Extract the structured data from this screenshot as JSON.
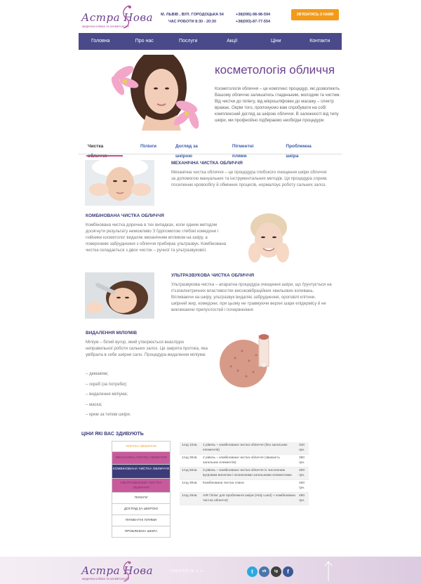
{
  "header": {
    "logo_title": "Астра Нова",
    "logo_sub": "медична клініка та косметологія",
    "address_line1": "М. ЛЬВІВ , ВУЛ. ГОРОДОЦЬКА 54",
    "address_line2": "ЧАС РОБОТИ 8:30 - 20:30",
    "phone1": "+38(096)-98-98-594",
    "phone2": "+38(093)-87-77-554",
    "call_button": "ЗВ'ЯЗАТИСЬ З НАМИ"
  },
  "nav": [
    "Головна",
    "Про нас",
    "Послуги",
    "Акції",
    "Ціни",
    "Контакти"
  ],
  "hero": {
    "title": "косметологія обличчя",
    "text": "Косметологія обличчя – це комплекс процедур, які дозволяють Вашому обличчю залишатись гладеньким, молодим та чистим. Від чистки до пілінгу, від мікрошліфовки до масажу – спектр вражає. Окрім того, пропонуємо вам спробувати на собі комплексний догляд за шкірою обличчя. В залежності від типу шкіри, ми професійно підбираємо необхідні процедури."
  },
  "tabs": [
    "Чистка обличчя",
    "Пілінги",
    "Догляд за шкірою",
    "Пігментні плями",
    "Проблемна шкіра"
  ],
  "sections": {
    "s1": {
      "title": "МЕХАНІЧНА ЧИСТКА ОБЛИЧЧЯ",
      "text": "Механічна чистка обличчя – це процедура глибокого очищення шкіри обличчя за допомогою мануальних та інструментальних методів. Ця процедура сприяє посиленню кровообігу й обмінних процесів, нормалізує роботу сальних залоз."
    },
    "s2": {
      "title": "КОМБІНОВАНА ЧИСТКА ОБЛИЧЧЯ",
      "text": "Комбінована чистка доречна в тих випадках, коли одним методом досягнути результату неможливо З їїдопомогою глибокі комедони і гнійники косметолог видаляє механічним впливом на шкіру, а поверхневе забруднення з обличчя прибирає ультразвук. Комбінована чистка складається з двох чисток – ручної та ультразвукової."
    },
    "s3": {
      "title": "УЛЬТРАЗВУКОВА ЧИСТКА ОБЛИЧЧЯ",
      "text": "Ультразвукова чистка – апаратна процедура очищення шкіри, що ґрунтується на п'єзоелектричних властивостях високовібраційних хвильових коливань. Впливаючи на шкіру, ультразвук видаляє забруднення, ороговілі клітини, шкірний жир, комедони, при цьому не травмуючи верхні шари епідермісу й не викликаючи припухлостей і почервоніння"
    },
    "s4": {
      "title": "ВИДАЛЕННЯ МІЛІУМІВ",
      "text": "Міліум – білий вугор, який утворюється внаслідок неправильної роботи сальних залоз. Це закрита протока, яка увібрала в себе шкірне сало. Процедура видалення міліума:",
      "list": [
        "– демакіяж;",
        "– скраб (за потреби);",
        "– видалення міліума;",
        "– маска;",
        "– крем за типом шкіри."
      ]
    }
  },
  "prices": {
    "title": "ЦІНИ ЯКІ ВАС ЗДИВУЮТЬ",
    "menu": [
      "ЧИСТКА ОБЛИЧЧЯ",
      "МЕХАНІЧНА ЧИСТКА ОБЛИЧЧЯ",
      "КОМБІНОВАНА ЧИСТКА ОБЛИЧЧЯ",
      "УЛЬТРАЗВУКОВА ЧИСТКА ОБЛИЧЧЯ",
      "ПІЛІНГИ",
      "ДОГЛЯД ЗА ШКІРОЮ",
      "ПІГМЕНТНІ ПЛЯМИ",
      "ПРОБЛЕМНА ШКІРА"
    ],
    "rows": [
      {
        "time": "1год 10хв.",
        "desc": "1 рівень – комбінована чистка обличчя (без загальних елементів)",
        "price": "340 грн."
      },
      {
        "time": "1год 30хв.",
        "desc": "2 рівень – комбінована чистка обличчя (зважаєть загальних елементів)",
        "price": "360 грн."
      },
      {
        "time": "1год 50хв.",
        "desc": "3 рівень – комбінована чистка обличчя із численним вугровим висипом і незначними загальними елементами",
        "price": "400 грн."
      },
      {
        "time": "1год 30хв.",
        "desc": "Комбінована чистка спини",
        "price": "450 грн."
      },
      {
        "time": "1год 45хв.",
        "desc": "AIR Пілінг для проблемної шкіри (Holy Land) + комбінована чистка обличчя)",
        "price": "490 грн."
      }
    ]
  },
  "footer": {
    "logo_title": "Астра Нова",
    "logo_sub": "медична клініка та косметологія",
    "credit": "CREATED IN",
    "social": [
      "t",
      "vk",
      "ig",
      "f"
    ]
  },
  "colors": {
    "nav": "#4a4a8a",
    "accent_orange": "#f39a1a",
    "accent_pink": "#c85a9c",
    "title_purple": "#6a3f8e"
  }
}
